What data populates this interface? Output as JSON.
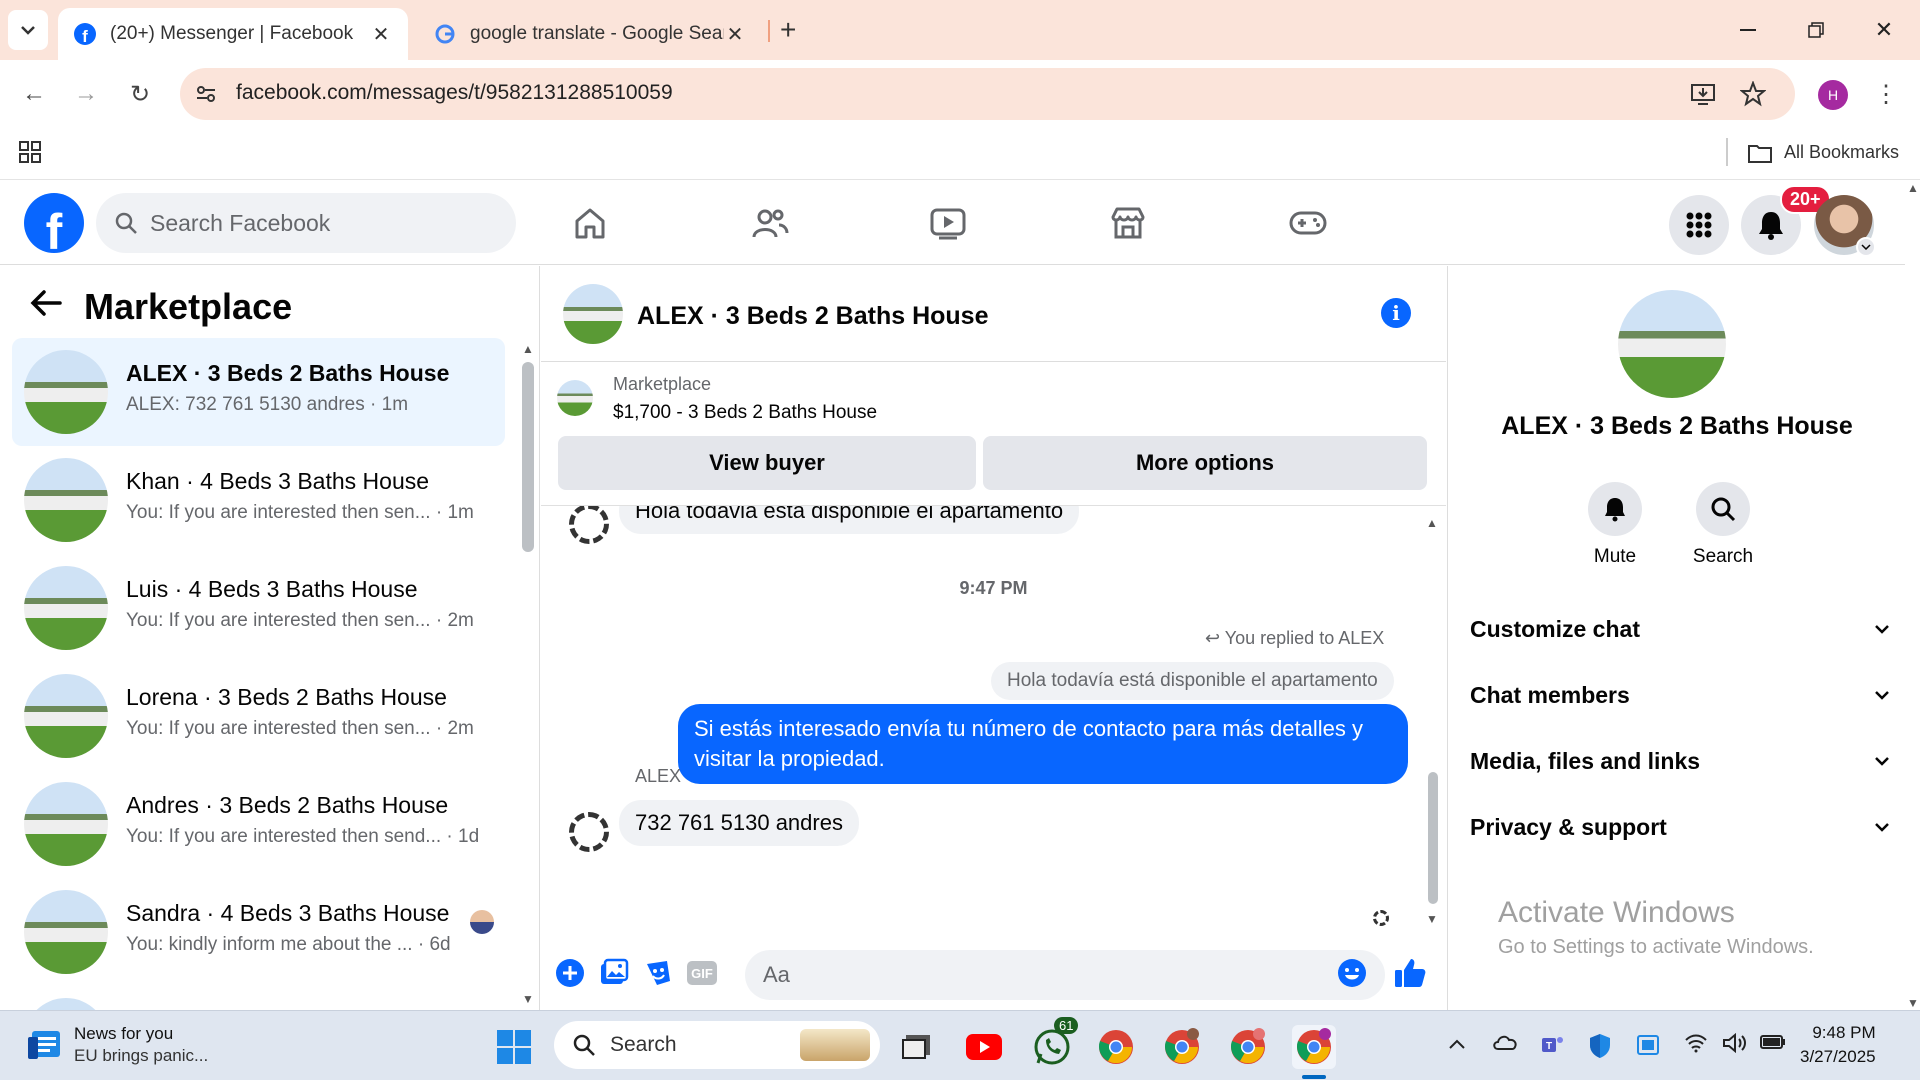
{
  "browser": {
    "tabs": [
      {
        "title": "(20+) Messenger | Facebook",
        "active": true
      },
      {
        "title": "google translate - Google Search",
        "active": false
      }
    ],
    "url": "facebook.com/messages/t/9582131288510059",
    "profile_initial": "H",
    "bookmarks_label": "All Bookmarks"
  },
  "fb": {
    "search_placeholder": "Search Facebook",
    "notification_badge": "20+"
  },
  "left": {
    "title": "Marketplace",
    "conversations": [
      {
        "name": "ALEX · 3 Beds 2 Baths House",
        "preview": "ALEX: 732 761 5130 andres · 1m",
        "selected": true
      },
      {
        "name": "Khan · 4 Beds 3 Baths House",
        "preview": "You: If you are interested then sen... · 1m",
        "selected": false
      },
      {
        "name": "Luis · 4 Beds 3 Baths House",
        "preview": "You: If you are interested then sen... · 2m",
        "selected": false
      },
      {
        "name": "Lorena · 3 Beds 2 Baths House",
        "preview": "You: If you are interested then sen... · 2m",
        "selected": false
      },
      {
        "name": "Andres · 3 Beds 2 Baths House",
        "preview": "You: If you are interested then send... · 1d",
        "selected": false
      },
      {
        "name": "Sandra · 4 Beds 3 Baths House",
        "preview": "You: kindly inform me about the ... · 6d",
        "selected": false
      }
    ]
  },
  "chat": {
    "title": "ALEX · 3 Beds 2 Baths House",
    "marketplace_label": "Marketplace",
    "listing": "$1,700 - 3 Beds 2 Baths House",
    "view_buyer": "View buyer",
    "more_options": "More options",
    "messages": {
      "first_incoming": "Hola todavia esta disponible el apartamento",
      "timestamp": "9:47 PM",
      "replied_to": "You replied to ALEX",
      "quoted": "Hola todavía está disponible el apartamento",
      "outgoing": "Si estás interesado envía tu número de contacto para más detalles y visitar la propiedad.",
      "sender": "ALEX",
      "last_incoming": "732 761 5130 andres"
    },
    "composer_placeholder": "Aa"
  },
  "right": {
    "name": "ALEX · 3 Beds 2 Baths House",
    "mute_label": "Mute",
    "search_label": "Search",
    "sections": [
      "Customize chat",
      "Chat members",
      "Media, files and links",
      "Privacy & support"
    ],
    "activate_title": "Activate Windows",
    "activate_sub": "Go to Settings to activate Windows."
  },
  "taskbar": {
    "news_title": "News for you",
    "news_sub": "EU brings panic...",
    "search_label": "Search",
    "whatsapp_badge": "61",
    "time": "9:48 PM",
    "date": "3/27/2025"
  },
  "colors": {
    "brand": "#0866ff",
    "tabbar": "#fbe4da",
    "badge": "#e41e3f"
  }
}
